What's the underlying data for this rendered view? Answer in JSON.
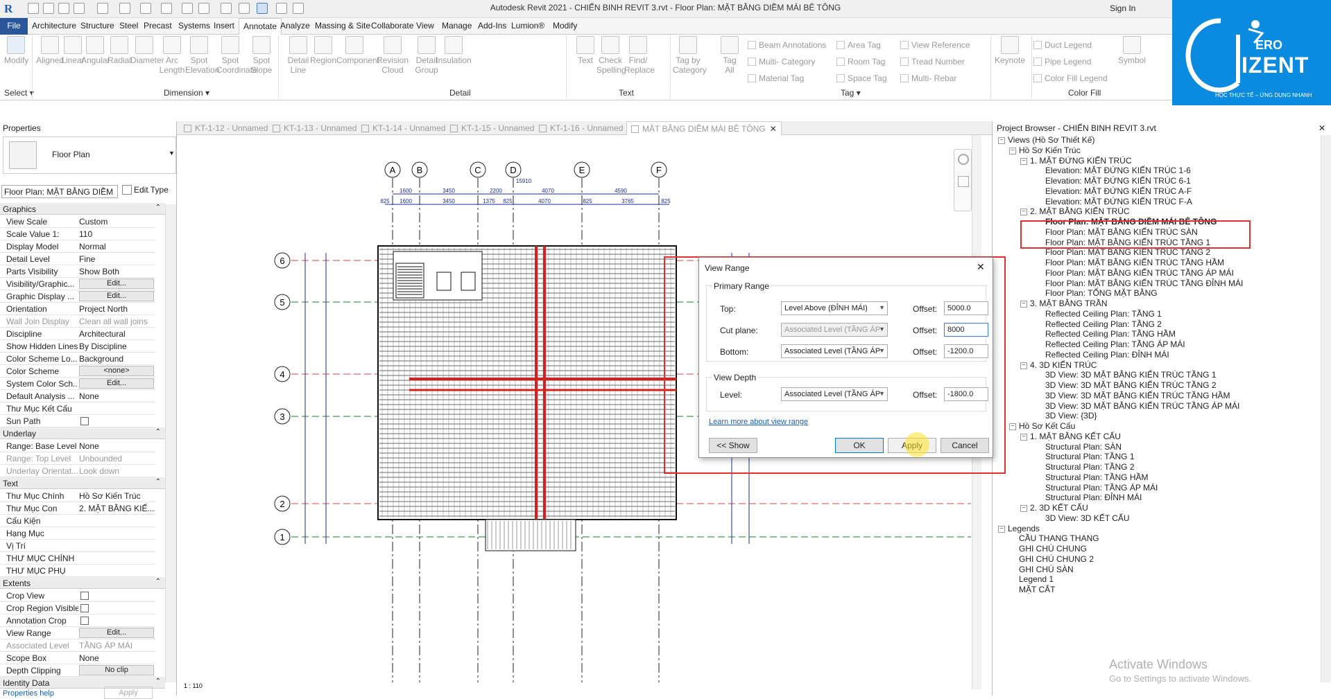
{
  "app": {
    "title": "Autodesk Revit 2021 - CHIẾN BINH REVIT 3.rvt - Floor Plan: MẶT BẰNG DIỀM MÁI BÊ TÔNG",
    "sign_in": "Sign In",
    "logo_text": "ERO",
    "logo_big": "IZENT",
    "logo_tagline": "HỌC THỰC TẾ – ỨNG DỤNG NHANH"
  },
  "ribbon_tabs": [
    "File",
    "Architecture",
    "Structure",
    "Steel",
    "Precast",
    "Systems",
    "Insert",
    "Annotate",
    "Analyze",
    "Massing & Site",
    "Collaborate",
    "View",
    "Manage",
    "Add-Ins",
    "Lumion®",
    "Modify"
  ],
  "ribbon": {
    "modify": "Modify",
    "select_label": "Select",
    "dimension_buttons": [
      "Aligned",
      "Linear",
      "Angular",
      "Radial",
      "Diameter",
      "Arc\nLength",
      "Spot\nElevation",
      "Spot\nCoordinate",
      "Spot\nSlope"
    ],
    "dimension_label": "Dimension",
    "detail_buttons": [
      "Detail\nLine",
      "Region",
      "Component",
      "Revision\nCloud",
      "Detail\nGroup",
      "Insulation"
    ],
    "detail_label": "Detail",
    "text_buttons": [
      "Text",
      "Check\nSpelling",
      "Find/\nReplace"
    ],
    "text_label": "Text",
    "tag_buttons": [
      "Tag by\nCategory",
      "Tag\nAll"
    ],
    "tag_small": [
      "Beam Annotations",
      "Multi- Category",
      "Material Tag",
      "Area Tag",
      "Room Tag",
      "Space Tag",
      "View Reference",
      "Tread Number",
      "Multi- Rebar"
    ],
    "tag_label": "Tag",
    "keynote": "Keynote",
    "symbol": "Symbol",
    "colorfill_small": [
      "Duct Legend",
      "Pipe Legend",
      "Color Fill Legend"
    ],
    "colorfill_label": "Color Fill"
  },
  "properties": {
    "header": "Properties",
    "type_name": "Floor Plan",
    "instance_selector": "Floor Plan: MẶT BẰNG DIỀM",
    "edit_type": "Edit Type",
    "help": "Properties help",
    "apply": "Apply",
    "categories": {
      "graphics": "Graphics",
      "underlay": "Underlay",
      "text": "Text",
      "extents": "Extents",
      "identity": "Identity Data"
    },
    "graphics_rows": [
      {
        "k": "View Scale",
        "v": "Custom"
      },
      {
        "k": "Scale Value    1:",
        "v": "110"
      },
      {
        "k": "Display Model",
        "v": "Normal"
      },
      {
        "k": "Detail Level",
        "v": "Fine"
      },
      {
        "k": "Parts Visibility",
        "v": "Show Both"
      },
      {
        "k": "Visibility/Graphic...",
        "v": "Edit..."
      },
      {
        "k": "Graphic Display ...",
        "v": "Edit..."
      },
      {
        "k": "Orientation",
        "v": "Project North"
      },
      {
        "k": "Wall Join Display",
        "v": "Clean all wall joins"
      },
      {
        "k": "Discipline",
        "v": "Architectural"
      },
      {
        "k": "Show Hidden Lines",
        "v": "By Discipline"
      },
      {
        "k": "Color Scheme Lo...",
        "v": "Background"
      },
      {
        "k": "Color Scheme",
        "v": "<none>"
      },
      {
        "k": "System Color Sch...",
        "v": "Edit..."
      },
      {
        "k": "Default Analysis ...",
        "v": "None"
      },
      {
        "k": "Thư Mục Kết Cấu",
        "v": ""
      },
      {
        "k": "Sun Path",
        "v": ""
      }
    ],
    "underlay_rows": [
      {
        "k": "Range: Base Level",
        "v": "None"
      },
      {
        "k": "Range: Top Level",
        "v": "Unbounded"
      },
      {
        "k": "Underlay Orientat...",
        "v": "Look down"
      }
    ],
    "text_rows": [
      {
        "k": "Thư Mục Chính",
        "v": "Hồ Sơ Kiến Trúc"
      },
      {
        "k": "Thư Mục Con",
        "v": "2. MẶT BẰNG KIẾ..."
      },
      {
        "k": "Cấu Kiện",
        "v": ""
      },
      {
        "k": "Hạng Mục",
        "v": ""
      },
      {
        "k": "Vị Trí",
        "v": ""
      },
      {
        "k": "THƯ MỤC CHÍNH",
        "v": ""
      },
      {
        "k": "THƯ MỤC PHỤ",
        "v": ""
      }
    ],
    "extents_rows": [
      {
        "k": "Crop View",
        "v": ""
      },
      {
        "k": "Crop Region Visible",
        "v": ""
      },
      {
        "k": "Annotation Crop",
        "v": ""
      },
      {
        "k": "View Range",
        "v": "Edit..."
      },
      {
        "k": "Associated Level",
        "v": "TẦNG ÁP MÁI"
      },
      {
        "k": "Scope Box",
        "v": "None"
      },
      {
        "k": "Depth Clipping",
        "v": "No clip"
      }
    ]
  },
  "doc_tabs": [
    "KT-1-12 - Unnamed",
    "KT-1-13 - Unnamed",
    "KT-1-14 - Unnamed",
    "KT-1-15 - Unnamed",
    "KT-1-16 - Unnamed",
    "MẶT BẰNG DIỀM MÁI BÊ TÔNG"
  ],
  "drawing": {
    "grid_cols": [
      "A",
      "B",
      "C",
      "D",
      "E",
      "F"
    ],
    "grid_rows": [
      "6",
      "5",
      "4",
      "3",
      "2",
      "1"
    ],
    "dims_top": [
      "1600",
      "3450",
      "2200",
      "4070",
      "4590"
    ],
    "dims_top2": [
      "825",
      "1600",
      "3450",
      "1375",
      "825",
      "4070",
      "825",
      "3765",
      "825"
    ],
    "overall": "15910",
    "scale_ctrl": "1 : 110"
  },
  "dialog": {
    "title": "View Range",
    "primary": "Primary Range",
    "top_label": "Top:",
    "top_value": "Level Above (ĐỈNH MÁI)",
    "cut_label": "Cut plane:",
    "cut_value": "Associated Level (TẦNG ÁP",
    "bottom_label": "Bottom:",
    "bottom_value": "Associated Level (TẦNG ÁP",
    "offset_label": "Offset:",
    "top_offset": "5000.0",
    "cut_offset": "8000",
    "bottom_offset": "-1200.0",
    "depth_group": "View Depth",
    "level_label": "Level:",
    "level_value": "Associated Level (TẦNG ÁP",
    "level_offset": "-1800.0",
    "link": "Learn more about view range",
    "show": "<< Show",
    "ok": "OK",
    "apply": "Apply",
    "cancel": "Cancel"
  },
  "browser": {
    "header": "Project Browser - CHIẾN BINH REVIT 3.rvt",
    "nodes": [
      {
        "t": "Views (Hồ Sơ Thiết Kế)",
        "lvl": 0,
        "exp": "-"
      },
      {
        "t": "Hồ Sơ Kiến Trúc",
        "lvl": 1,
        "exp": "-"
      },
      {
        "t": "1. MẶT ĐỨNG KIẾN TRÚC",
        "lvl": 2,
        "exp": "-"
      },
      {
        "t": "Elevation: MẶT ĐỨNG KIẾN TRÚC 1-6",
        "lvl": 3
      },
      {
        "t": "Elevation: MẶT ĐỨNG KIẾN TRÚC 6-1",
        "lvl": 3
      },
      {
        "t": "Elevation: MẶT ĐỨNG KIẾN TRÚC A-F",
        "lvl": 3
      },
      {
        "t": "Elevation: MẶT ĐỨNG KIẾN TRÚC F-A",
        "lvl": 3
      },
      {
        "t": "2. MẶT BẰNG KIẾN TRÚC",
        "lvl": 2,
        "exp": "-"
      },
      {
        "t": "Floor Plan: MẶT BẰNG DIỀM MÁI BÊ TÔNG",
        "lvl": 3,
        "bold": true
      },
      {
        "t": "Floor Plan: MẶT BẰNG KIẾN TRÚC SÀN",
        "lvl": 3
      },
      {
        "t": "Floor Plan: MẶT BẰNG KIẾN TRÚC TẦNG 1",
        "lvl": 3
      },
      {
        "t": "Floor Plan: MẶT BẰNG KIẾN TRÚC TẦNG 2",
        "lvl": 3
      },
      {
        "t": "Floor Plan: MẶT BẰNG KIẾN TRÚC TẦNG HẦM",
        "lvl": 3
      },
      {
        "t": "Floor Plan: MẶT BẰNG KIẾN TRÚC TẦNG ÁP MÁI",
        "lvl": 3
      },
      {
        "t": "Floor Plan: MẶT BẰNG KIẾN TRÚC TẦNG ĐỈNH MÁI",
        "lvl": 3
      },
      {
        "t": "Floor Plan: TỔNG MẶT BẰNG",
        "lvl": 3
      },
      {
        "t": "3. MẶT BẰNG TRẦN",
        "lvl": 2,
        "exp": "-"
      },
      {
        "t": "Reflected Ceiling Plan: TẦNG 1",
        "lvl": 3
      },
      {
        "t": "Reflected Ceiling Plan: TẦNG 2",
        "lvl": 3
      },
      {
        "t": "Reflected Ceiling Plan: TẦNG HẦM",
        "lvl": 3
      },
      {
        "t": "Reflected Ceiling Plan: TẦNG ÁP MÁI",
        "lvl": 3
      },
      {
        "t": "Reflected Ceiling Plan: ĐỈNH MÁI",
        "lvl": 3
      },
      {
        "t": "4. 3D KIẾN TRÚC",
        "lvl": 2,
        "exp": "-"
      },
      {
        "t": "3D View: 3D MẶT BẰNG KIẾN TRÚC TẦNG 1",
        "lvl": 3
      },
      {
        "t": "3D View: 3D MẶT BẰNG KIẾN TRÚC TẦNG 2",
        "lvl": 3
      },
      {
        "t": "3D View: 3D MẶT BẰNG KIẾN TRÚC TẦNG HẦM",
        "lvl": 3
      },
      {
        "t": "3D View: 3D MẶT BẰNG KIẾN TRÚC TẦNG ÁP MÁI",
        "lvl": 3
      },
      {
        "t": "3D View: {3D}",
        "lvl": 3
      },
      {
        "t": "Hồ Sơ Kết Cấu",
        "lvl": 1,
        "exp": "-"
      },
      {
        "t": "1. MẶT BẰNG KẾT CẤU",
        "lvl": 2,
        "exp": "-"
      },
      {
        "t": "Structural Plan: SÀN",
        "lvl": 3
      },
      {
        "t": "Structural Plan: TẦNG 1",
        "lvl": 3
      },
      {
        "t": "Structural Plan: TẦNG 2",
        "lvl": 3
      },
      {
        "t": "Structural Plan: TẦNG HẦM",
        "lvl": 3
      },
      {
        "t": "Structural Plan: TẦNG ÁP MÁI",
        "lvl": 3
      },
      {
        "t": "Structural Plan: ĐỈNH MÁI",
        "lvl": 3
      },
      {
        "t": "2. 3D KẾT CẤU",
        "lvl": 2,
        "exp": "-"
      },
      {
        "t": "3D View: 3D KẾT CẤU",
        "lvl": 3
      },
      {
        "t": "Legends",
        "lvl": 0,
        "exp": "-"
      },
      {
        "t": "CẦU THANG THANG",
        "lvl": 1
      },
      {
        "t": "GHI CHÚ CHUNG",
        "lvl": 1
      },
      {
        "t": "GHI CHÚ CHUNG 2",
        "lvl": 1
      },
      {
        "t": "GHI CHÚ SÀN",
        "lvl": 1
      },
      {
        "t": "Legend 1",
        "lvl": 1
      },
      {
        "t": "MẶT CẮT",
        "lvl": 1
      }
    ],
    "activate_title": "Activate Windows",
    "activate_sub": "Go to Settings to activate Windows."
  }
}
